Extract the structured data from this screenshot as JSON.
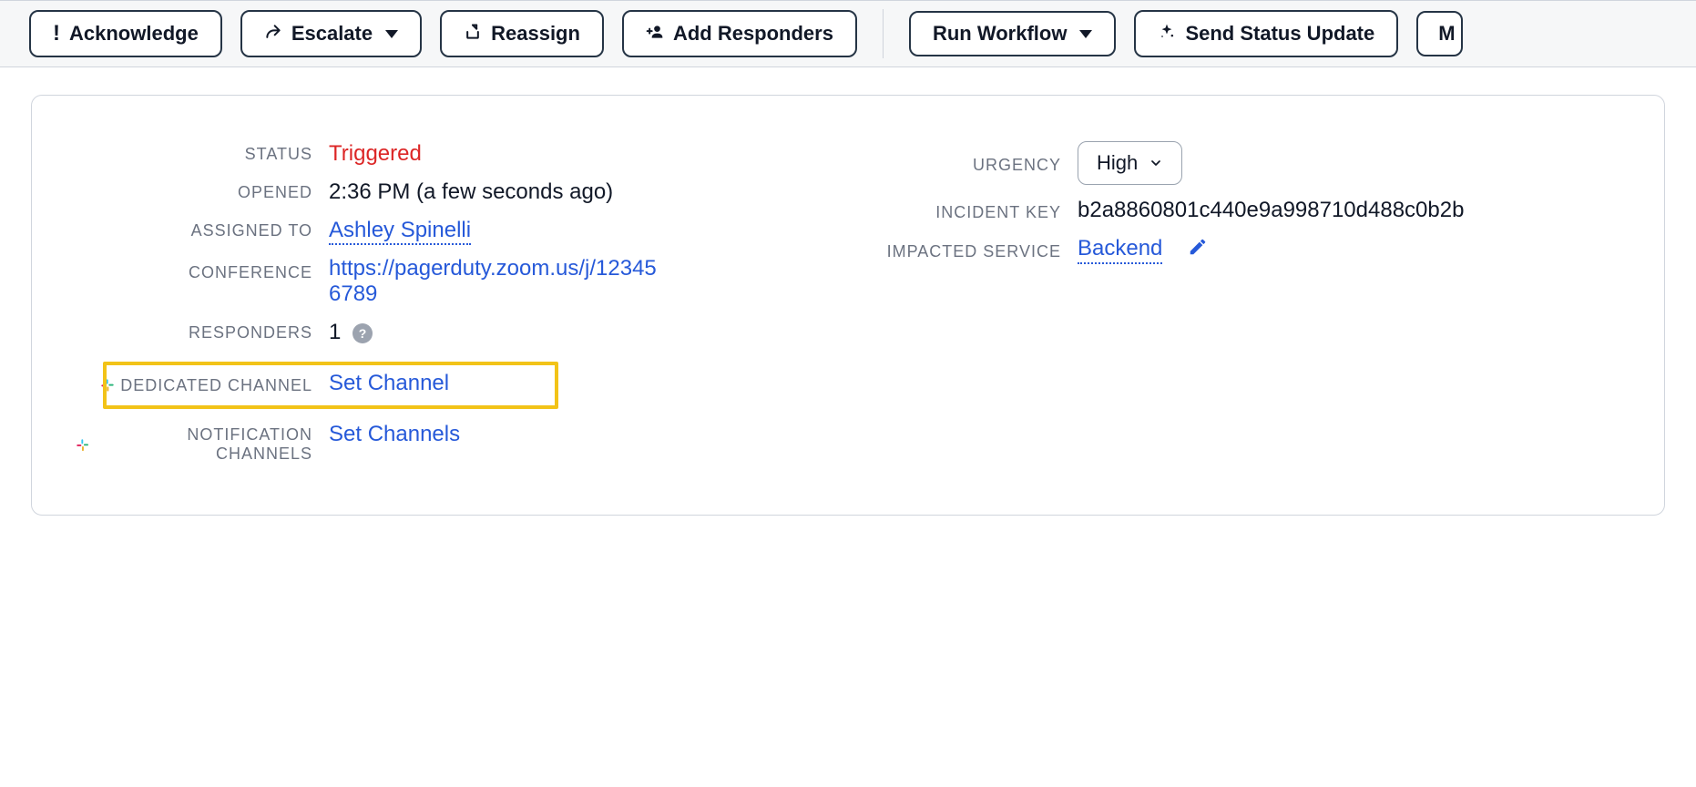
{
  "toolbar": {
    "acknowledge": "Acknowledge",
    "escalate": "Escalate",
    "reassign": "Reassign",
    "add_responders": "Add Responders",
    "run_workflow": "Run Workflow",
    "status_update": "Send Status Update",
    "overflow": "M"
  },
  "labels": {
    "status": "STATUS",
    "opened": "OPENED",
    "assigned_to": "ASSIGNED TO",
    "conference": "CONFERENCE",
    "responders": "RESPONDERS",
    "dedicated_channel": "DEDICATED CHANNEL",
    "notification_channels": "NOTIFICATION CHANNELS",
    "urgency": "URGENCY",
    "incident_key": "INCIDENT KEY",
    "impacted_service": "IMPACTED SERVICE"
  },
  "values": {
    "status": "Triggered",
    "opened": "2:36 PM (a few seconds ago)",
    "assigned_to": "Ashley Spinelli",
    "conference": "https://pagerduty.zoom.us/j/123456789",
    "responders_count": "1",
    "set_channel": "Set Channel",
    "set_channels": "Set Channels",
    "urgency": "High",
    "incident_key": "b2a8860801c440e9a998710d488c0b2b",
    "impacted_service": "Backend"
  }
}
